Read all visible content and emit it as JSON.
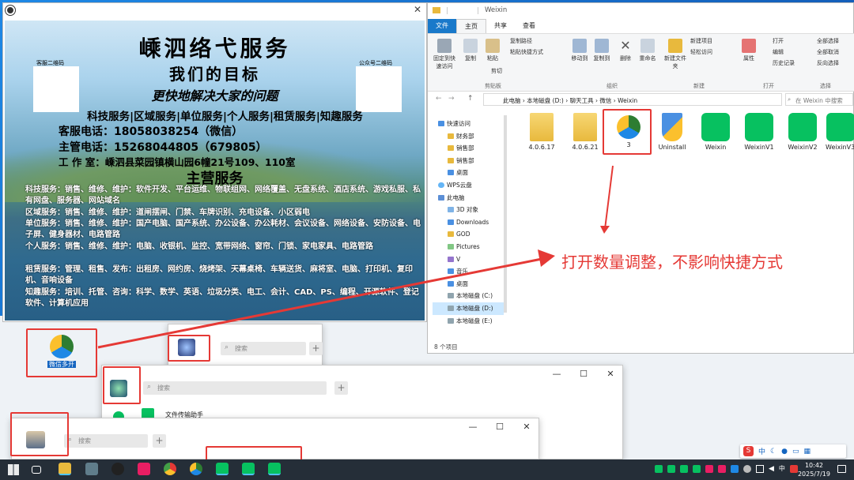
{
  "poster": {
    "title": "嵊泗络弋服务",
    "subtitle": "我们的目标",
    "slogan": "更快地解决大家的问题",
    "qr_left_caption": "客服二维码",
    "qr_right_caption": "公众号二维码",
    "services_line": "科技服务|区域服务|单位服务|个人服务|租赁服务|知趣服务",
    "phone_service": "客服电话：18058038254（微信）",
    "phone_manager": "主管电话：15268044805（679805）",
    "studio": "工 作 室：嵊泗县菜园镇横山园6幢21号109、110室",
    "main_heading": "主营服务",
    "details": [
      "科技服务：销售、维修、维护：软件开发、平台运维、物联组网、网络覆盖、无盘系统、酒店系统、游戏私服、私有网盘、服务器、网站域名",
      "区域服务：销售、维修、维护：道闸摆闸、门禁、车牌识别、充电设备、小区弱电",
      "单位服务：销售、维修、维护：国产电脑、国产系统、办公设备、办公耗材、会议设备、网络设备、安防设备、电子屏、健身器材、电路管路",
      "个人服务：销售、维修、维护：电脑、收银机、监控、宽带网络、窗帘、门锁、家电家具、电路管路",
      "租赁服务：管理、租售、发布：出租房、网约房、烧烤架、天幕桌椅、车辆送货、麻将室、电脑、打印机、复印机、音响设备",
      "知趣服务：培训、托管、咨询：科学、数学、英语、垃圾分类、电工、会计、CAD、PS、编程、开源软件、登记软件、计算机应用"
    ]
  },
  "explorer": {
    "title": "Weixin",
    "tabs": [
      "文件",
      "主页",
      "共享",
      "查看"
    ],
    "ribbon": {
      "pin": "固定到快速访问",
      "copy": "复制",
      "paste": "粘贴",
      "copy_path": "复制路径",
      "paste_shortcut": "粘贴快捷方式",
      "cut": "剪切",
      "move_to": "移动到",
      "copy_to": "复制到",
      "delete": "删除",
      "rename": "重命名",
      "new_folder": "新建文件夹",
      "new_item": "新建项目",
      "easy_access": "轻松访问",
      "properties": "属性",
      "open": "打开",
      "edit": "编辑",
      "history": "历史记录",
      "select_all": "全部选择",
      "select_none": "全部取消",
      "invert": "反向选择",
      "group_clipboard": "剪贴板",
      "group_organize": "组织",
      "group_new": "新建",
      "group_open": "打开",
      "group_select": "选择"
    },
    "path": [
      "此电脑",
      "本地磁盘 (D:)",
      "聊天工具",
      "微信",
      "Weixin"
    ],
    "search_placeholder": "在 Weixin 中搜索",
    "nav": [
      "快速访问",
      "财务部",
      "销售部",
      "销售部",
      "桌面",
      "WPS云盘",
      "此电脑",
      "3D 对象",
      "Downloads",
      "GOD",
      "Pictures",
      "V",
      "音乐",
      "桌面",
      "本地磁盘 (C:)",
      "本地磁盘 (D:)",
      "本地磁盘 (E:)"
    ],
    "files": [
      "4.0.6.17",
      "4.0.6.21",
      "3",
      "Uninstall",
      "Weixin",
      "WeixinV1",
      "WeixinV2",
      "WeixinV3"
    ],
    "status": "8 个项目"
  },
  "desktop": {
    "shortcut_label": "微信多开",
    "search_placeholder": "搜索",
    "chat_item": "文件传输助手"
  },
  "annotation": "打开数量调整，不影响快捷方式",
  "taskbar": {
    "time": "10:42",
    "date": "2025/7/19",
    "ime_lang": "中"
  },
  "colors": {
    "accent": "#1979ca",
    "wechat": "#07c160",
    "annotation": "#e53935"
  }
}
